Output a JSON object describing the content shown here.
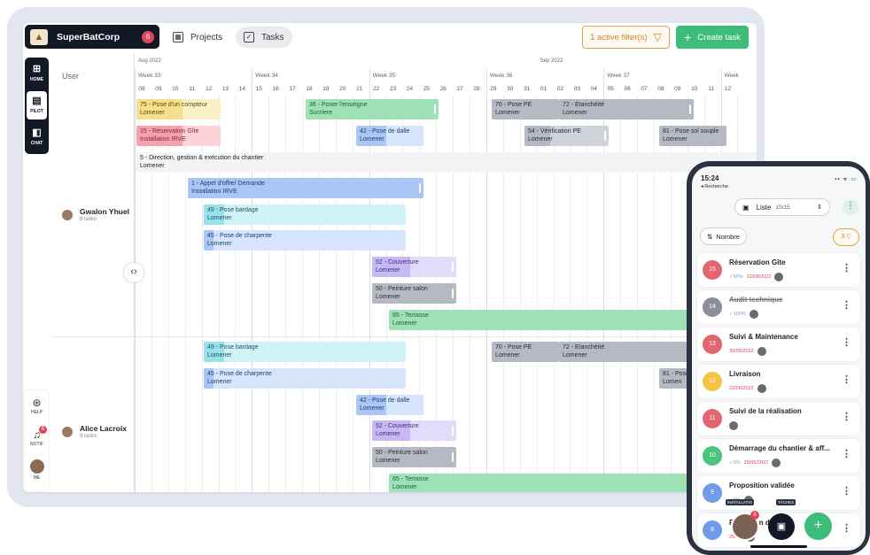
{
  "header": {
    "brand_name": "SuperBatCorp",
    "brand_badge": "6",
    "tabs": [
      {
        "label": "Projects",
        "icon": "building-icon"
      },
      {
        "label": "Tasks",
        "icon": "clipboard-icon"
      }
    ],
    "filter_label": "1 active filter(s)",
    "create_label": "Create task"
  },
  "sidebar": {
    "items": [
      {
        "label": "HOME",
        "icon": "map-icon"
      },
      {
        "label": "PILOT",
        "icon": "calendar-icon"
      },
      {
        "label": "CHAT",
        "icon": "chat-icon"
      }
    ],
    "bottom": [
      {
        "label": "HELP",
        "icon": "help-icon"
      },
      {
        "label": "NOTIF",
        "icon": "bell-icon",
        "badge": "6"
      },
      {
        "label": "ME",
        "icon": "avatar"
      }
    ]
  },
  "gantt": {
    "user_header": "User",
    "months": [
      "Aug 2022",
      "Sep 2022"
    ],
    "weeks": [
      "Week 33",
      "Week 34",
      "Week 35",
      "Week 36",
      "Week 37",
      "Week"
    ],
    "days": [
      "08",
      "09",
      "10",
      "11",
      "12",
      "13",
      "14",
      "15",
      "16",
      "17",
      "18",
      "19",
      "20",
      "21",
      "22",
      "23",
      "24",
      "25",
      "26",
      "27",
      "28",
      "29",
      "30",
      "31",
      "01",
      "02",
      "03",
      "04",
      "05",
      "06",
      "07",
      "08",
      "09",
      "10",
      "11",
      "12"
    ],
    "users": [
      {
        "name": "Gwalon Yhuel",
        "tasks": "8 tasks"
      },
      {
        "name": "Alice Lacroix",
        "tasks": "9 tasks"
      }
    ],
    "bars": [
      {
        "t1": "75 - Pose d'un compteur",
        "t2": "Lomener"
      },
      {
        "t1": "36 - Poser l'enseigne",
        "t2": "Sucriere"
      },
      {
        "t1": "70 - Pose PE",
        "t2": "Lomener"
      },
      {
        "t1": "72 - Etanchéité",
        "t2": "Lomener"
      },
      {
        "t1": "15 - Réservation Gîte",
        "t2": "Installation IRVE"
      },
      {
        "t1": "42 - Pose de dalle",
        "t2": "Lomener"
      },
      {
        "t1": "54 - Vérification PE",
        "t2": "Lomener"
      },
      {
        "t1": "81 - Pose sol souple",
        "t2": "Lomener"
      },
      {
        "t1": "5 - Direction, gestion & exécution du chantier",
        "t2": "Lomener"
      },
      {
        "t1": "1 - Appel d'offre/ Demande",
        "t2": "Installation IRVE"
      },
      {
        "t1": "49 - Pose bardage",
        "t2": "Lomener"
      },
      {
        "t1": "45 - Pose de charpente",
        "t2": "Lomener"
      },
      {
        "t1": "52 - Couverture",
        "t2": "Lomener"
      },
      {
        "t1": "50 - Peinture salon",
        "t2": "Lomener"
      },
      {
        "t1": "65 - Terrasse",
        "t2": "Lomener"
      },
      {
        "t1": "49 - Pose bardage",
        "t2": "Lomener"
      },
      {
        "t1": "70 - Pose PE",
        "t2": "Lomener"
      },
      {
        "t1": "72 - Etanchéité",
        "t2": "Lomener"
      },
      {
        "t1": "45 - Pose de charpente",
        "t2": "Lomener"
      },
      {
        "t1": "81 - Pose",
        "t2": "Lomen"
      },
      {
        "t1": "42 - Pose de dalle",
        "t2": "Lomener"
      },
      {
        "t1": "52 - Couverture",
        "t2": "Lomener"
      },
      {
        "t1": "50 - Peinture salon",
        "t2": "Lomener"
      },
      {
        "t1": "65 - Terrasse",
        "t2": "Lomener"
      }
    ]
  },
  "phone": {
    "time": "15:24",
    "back": "◂ Recherche",
    "status": "▪▪ ᯤ ▭",
    "select_label": "Liste",
    "select_count": "15/15",
    "sort_label": "Nombre",
    "filter_count": "3",
    "cards": [
      {
        "num": "15",
        "title": "Réservation Gîte",
        "progress": "✓50%",
        "date": "12/08/2022",
        "color": "#e36570"
      },
      {
        "num": "14",
        "title": "Audit technique",
        "progress": "✓100%",
        "date": "",
        "color": "#8a8f99"
      },
      {
        "num": "13",
        "title": "Suivi & Maintenance",
        "progress": "",
        "date": "30/05/2022",
        "color": "#e36570"
      },
      {
        "num": "12",
        "title": "Livraison",
        "progress": "",
        "date": "22/06/2022",
        "color": "#f5c542"
      },
      {
        "num": "11",
        "title": "Suivi de la réalisation",
        "progress": "",
        "date": "",
        "color": "#e36570"
      },
      {
        "num": "10",
        "title": "Démarrage du chantier & aff...",
        "progress": "✓0%",
        "date": "25/05/2022",
        "color": "#4cc47f"
      },
      {
        "num": "9",
        "title": "Proposition validée",
        "progress": "✓0%",
        "date": "",
        "color": "#6f9be8"
      },
      {
        "num": "8",
        "title": "Réception de la",
        "progress": "",
        "date": "25/05/",
        "color": "#6f9be8"
      }
    ],
    "tag_left": "INSTALLATIO",
    "tag_right": "TÂCHES",
    "avatar_badge": "6"
  },
  "colors": {
    "accent": "#3dbc7a",
    "brand_dark": "#121826",
    "filter": "#e3a548",
    "badge": "#e1435b"
  }
}
